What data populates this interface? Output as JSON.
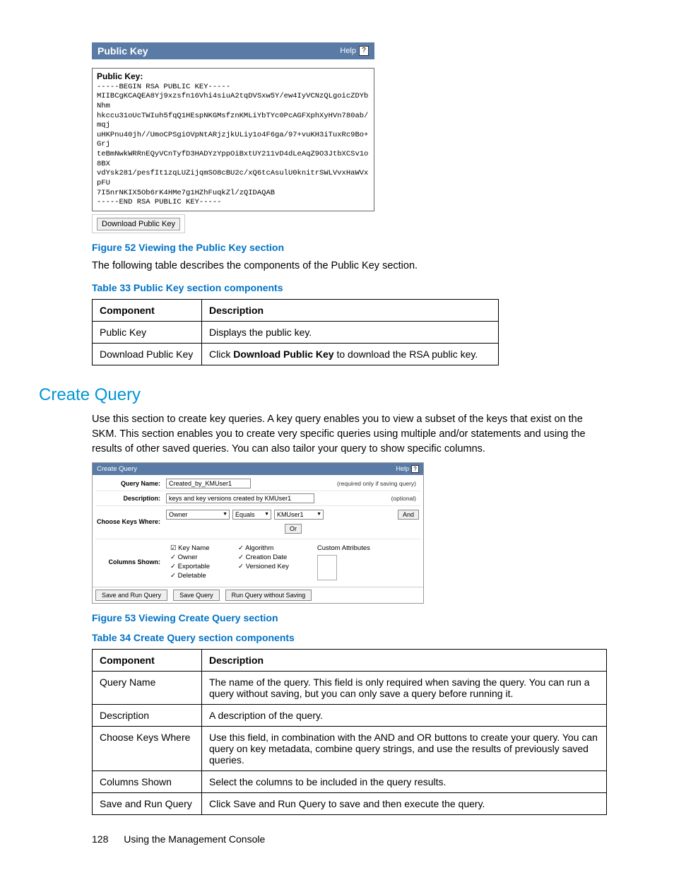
{
  "publicKeyPanel": {
    "header": "Public Key",
    "help": "Help",
    "boxLabel": "Public Key:",
    "keyLines": [
      "-----BEGIN RSA PUBLIC KEY-----",
      "MIIBCgKCAQEA8Yj9xzsfn16Vhi4siuA2tqDVSxw5Y/ew4IyVCNzQLgoicZDYbNhm",
      "hkccu31oUcTWIuh5fqQ1HEspNKGMsfznKMLiYbTYc0PcAGFXphXyHVn780ab/mqj",
      "uHKPnu40jh//UmoCPSgiOVpNtARjzjkULiy1o4F6ga/97+vuKH3iTuxRc9Bo+Grj",
      "teBmNwkWRRnEQyVCnTyfD3HADYzYppOiBxtUY211vD4dLeAqZ9O3JtbXCSv1o8BX",
      "vdYsk281/pesfIt1zqLUZijqmSO8cBU2c/xQ6tcAsulU0knitrSWLVvxHaWVxpFU",
      "7I5nrNKIX5Ob6rK4HMe7g1HZhFuqkZl/zQIDAQAB",
      "-----END RSA PUBLIC KEY-----"
    ],
    "downloadBtn": "Download Public Key"
  },
  "figure52": "Figure 52 Viewing the Public Key section",
  "pkIntro": "The following table describes the components of the Public Key section.",
  "table33Caption": "Table 33 Public Key section components",
  "table33": {
    "headers": [
      "Component",
      "Description"
    ],
    "rows": [
      [
        "Public Key",
        "Displays the public key."
      ],
      [
        "Download Public Key",
        {
          "prefix": "Click ",
          "bold": "Download Public Key",
          "suffix": " to download the RSA public key."
        }
      ]
    ]
  },
  "createQuery": {
    "title": "Create Query",
    "intro": "Use this section to create key queries. A key query enables you to view a subset of the keys that exist on the SKM. This section enables you to create very specific queries using multiple and/or statements and using the results of other saved queries. You can also tailor your query to show specific columns."
  },
  "cqShot": {
    "header": "Create Query",
    "help": "Help",
    "queryNameLabel": "Query Name:",
    "queryNameValue": "Created_by_KMUser1",
    "queryNameNote": "(required only if saving query)",
    "descLabel": "Description:",
    "descValue": "keys and key versions created by KMUser1",
    "descNote": "(optional)",
    "chooseLabel": "Choose Keys Where:",
    "sel1": "Owner",
    "sel2": "Equals",
    "sel3": "KMUser1",
    "andBtn": "And",
    "orBtn": "Or",
    "columnsLabel": "Columns Shown:",
    "col1": [
      "Key Name",
      "Owner",
      "Exportable",
      "Deletable"
    ],
    "col2": [
      "Algorithm",
      "Creation Date",
      "Versioned Key"
    ],
    "col3Label": "Custom Attributes",
    "btnSaveRun": "Save and Run Query",
    "btnSave": "Save Query",
    "btnRun": "Run Query without Saving"
  },
  "figure53": "Figure 53 Viewing Create Query section",
  "table34Caption": "Table 34 Create Query section components",
  "table34": {
    "headers": [
      "Component",
      "Description"
    ],
    "rows": [
      [
        "Query Name",
        "The name of the query. This field is only required when saving the query. You can run a query without saving, but you can only save a query before running it."
      ],
      [
        "Description",
        "A description of the query."
      ],
      [
        "Choose Keys Where",
        "Use this field, in combination with the AND and OR buttons to create your query. You can query on key metadata, combine query strings, and use the results of previously saved queries."
      ],
      [
        "Columns Shown",
        "Select the columns to be included in the query results."
      ],
      [
        "Save and Run Query",
        "Click Save and Run Query to save and then execute the query."
      ]
    ]
  },
  "footer": {
    "page": "128",
    "section": "Using the Management Console"
  }
}
